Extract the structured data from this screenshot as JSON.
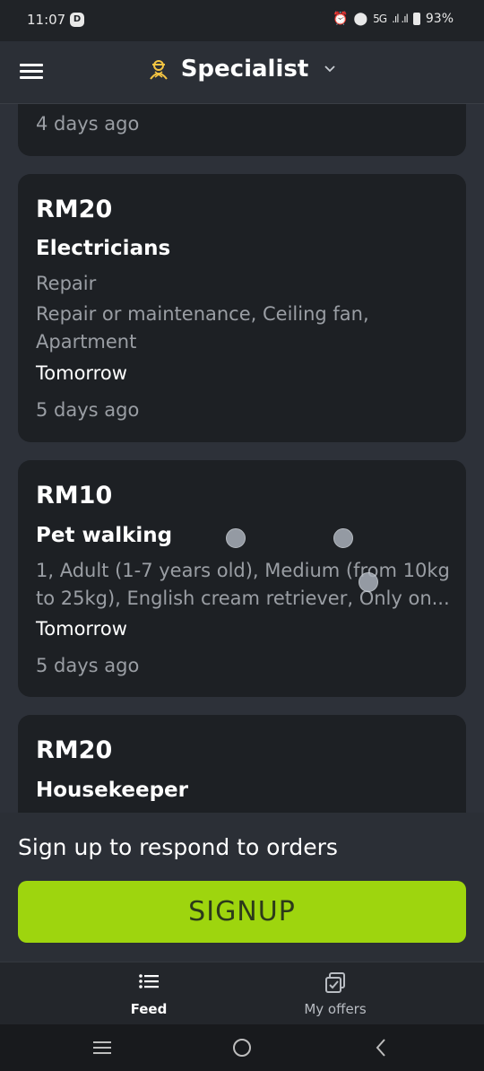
{
  "status_bar": {
    "time": "11:07",
    "app_badge": "D",
    "battery": "93%",
    "network": "5G"
  },
  "header": {
    "title": "Specialist"
  },
  "feed": {
    "partial_card": {
      "ago": "4 days ago"
    },
    "cards": [
      {
        "price": "RM20",
        "category": "Electricians",
        "subcategory": "Repair",
        "details_line1": "Repair or maintenance, Ceiling fan,",
        "details_line2": "Apartment",
        "when": "Tomorrow",
        "ago": "5 days ago"
      },
      {
        "price": "RM10",
        "category": "Pet walking",
        "details_line1": "1, Adult (1-7 years old), Medium (from 10kg",
        "details_line2": "to 25kg), English cream retriever, Only on...",
        "when": "Tomorrow",
        "ago": "5 days ago"
      },
      {
        "price": "RM20",
        "category": "Housekeeper"
      }
    ]
  },
  "signup": {
    "prompt": "Sign up to respond to orders",
    "button_label": "SIGNUP",
    "button_color": "#9ed50e"
  },
  "bottom_nav": {
    "items": [
      {
        "label": "Feed",
        "icon": "list-icon",
        "active": true
      },
      {
        "label": "My offers",
        "icon": "offers-icon",
        "active": false
      }
    ]
  },
  "system_nav": {
    "icons": [
      "recents-icon",
      "home-icon",
      "back-icon"
    ]
  }
}
